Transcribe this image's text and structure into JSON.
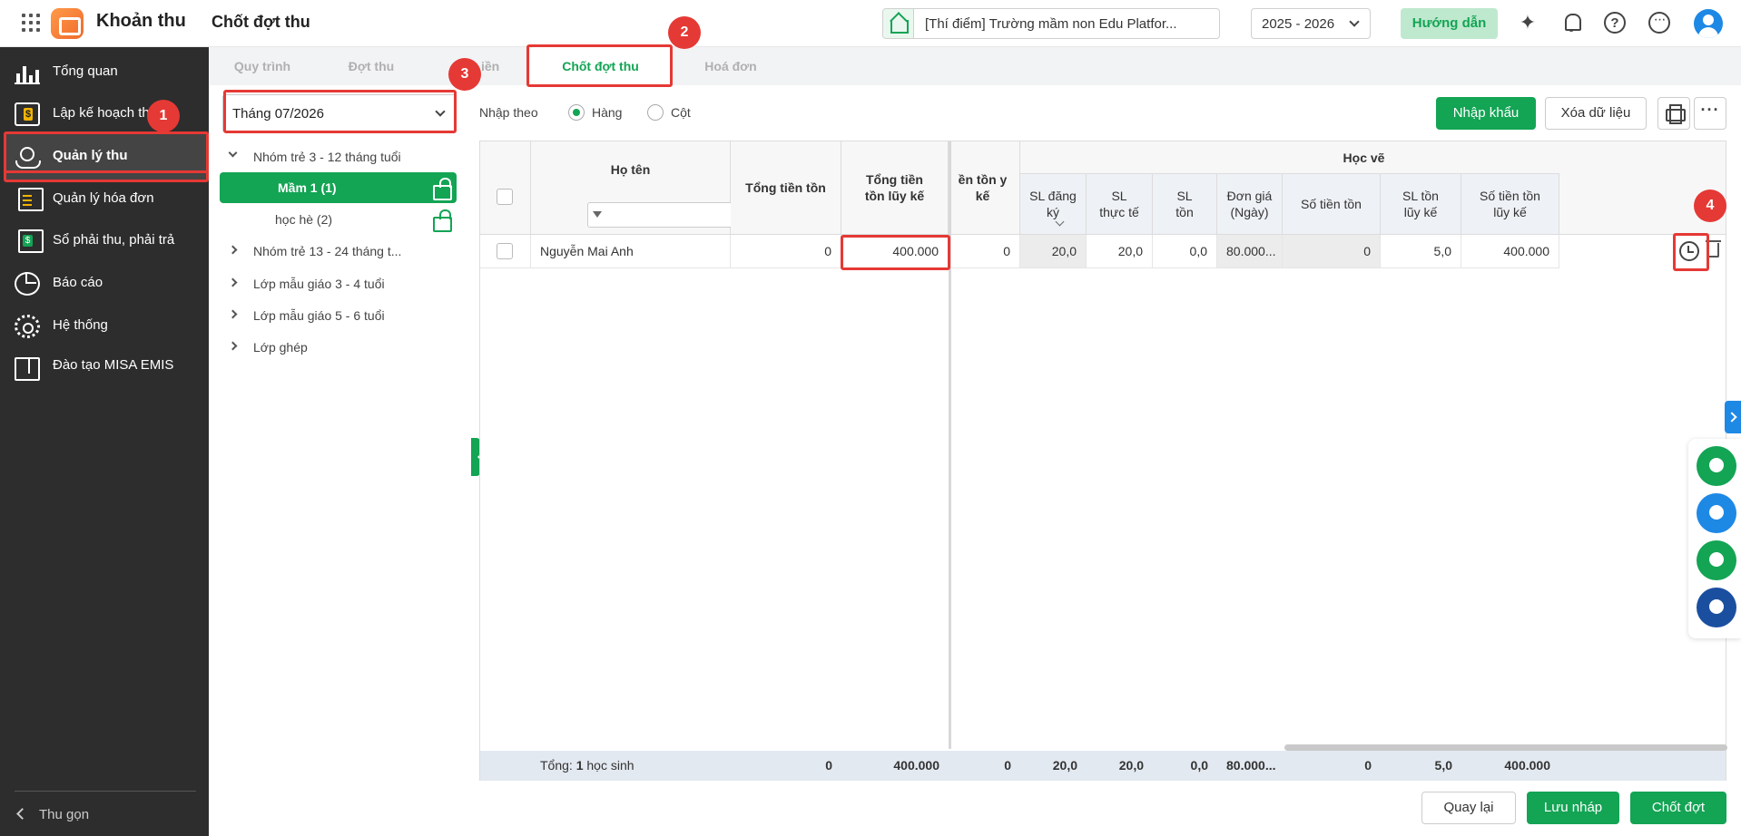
{
  "app": {
    "name": "Khoản thu",
    "page_title": "Chốt đợt thu"
  },
  "header": {
    "school": "[Thí điểm] Trường mầm non Edu Platfor...",
    "school_year": "2025 - 2026",
    "guide_label": "Hướng dẫn"
  },
  "sidebar": {
    "items": [
      {
        "label": "Tổng quan",
        "icon": "bar-chart-icon"
      },
      {
        "label": "Lập kế hoạch thu",
        "icon": "calendar-money-icon"
      },
      {
        "label": "Quản lý thu",
        "icon": "hand-coin-icon",
        "active": true
      },
      {
        "label": "Quản lý hóa đơn",
        "icon": "invoice-icon"
      },
      {
        "label": "Sổ phải thu, phải trả",
        "icon": "ledger-icon"
      },
      {
        "label": "Báo cáo",
        "icon": "pie-chart-icon"
      },
      {
        "label": "Hệ thống",
        "icon": "gear-icon"
      },
      {
        "label": "Đào tạo MISA EMIS",
        "icon": "open-book-icon"
      }
    ],
    "collapse_label": "Thu gọn"
  },
  "tabs": [
    {
      "label": "Quy trình"
    },
    {
      "label": "Đợt thu"
    },
    {
      "label": "iền"
    },
    {
      "label": "Chốt đợt thu",
      "active": true
    },
    {
      "label": "Hoá đơn"
    }
  ],
  "month_filter": "Tháng 07/2026",
  "tree": [
    {
      "label": "Nhóm trẻ 3 - 12 tháng tuổi",
      "expanded": true
    },
    {
      "label": "Mầm 1 (1)",
      "selected": true,
      "locked": true
    },
    {
      "label": "học hè (2)",
      "locked": true
    },
    {
      "label": "Nhóm trẻ 13 - 24 tháng t..."
    },
    {
      "label": "Lớp mẫu giáo 3 - 4 tuổi"
    },
    {
      "label": "Lớp mẫu giáo 5 - 6 tuổi"
    },
    {
      "label": "Lớp ghép"
    }
  ],
  "toolbar": {
    "input_by_label": "Nhập theo",
    "radio_row": "Hàng",
    "radio_col": "Cột",
    "selected_mode": "row",
    "import_label": "Nhập khẩu",
    "clear_label": "Xóa dữ liệu"
  },
  "grid": {
    "headers": {
      "name": "Họ tên",
      "total_balance": "Tổng tiền tồn",
      "total_accum": "Tổng tiền tồn lũy kế",
      "accum_partial": "ền tồn y kế",
      "group": "Học vẽ",
      "sl_registered": "SL đăng ký",
      "sl_actual": "SL thực tế",
      "sl_balance": "SL tồn",
      "unit_price": "Đơn giá (Ngày)",
      "balance_amount": "Số tiền tồn",
      "sl_accum": "SL tồn lũy kế",
      "amount_accum": "Số tiền tồn lũy kế"
    },
    "rows": [
      {
        "name": "Nguyễn Mai Anh",
        "total_balance": "0",
        "total_accum": "400.000",
        "accum_partial": "0",
        "sl_registered": "20,0",
        "sl_actual": "20,0",
        "sl_balance": "0,0",
        "unit_price": "80.000...",
        "balance_amount": "0",
        "sl_accum": "5,0",
        "amount_accum": "400.000"
      }
    ],
    "footer": {
      "total_prefix": "Tổng:",
      "total_count": "1",
      "total_suffix": "học sinh",
      "total_balance": "0",
      "total_accum": "400.000",
      "accum_partial": "0",
      "sl_registered": "20,0",
      "sl_actual": "20,0",
      "sl_balance": "0,0",
      "unit_price": "80.000...",
      "balance_amount": "0",
      "sl_accum": "5,0",
      "amount_accum": "400.000"
    }
  },
  "actions": {
    "back": "Quay lại",
    "save_draft": "Lưu nháp",
    "close_batch": "Chốt đợt"
  },
  "annotations": [
    "1",
    "2",
    "3",
    "4"
  ],
  "colors": {
    "primary": "#13a454",
    "highlight": "#e53935",
    "sidebar": "#2d2d2d"
  }
}
